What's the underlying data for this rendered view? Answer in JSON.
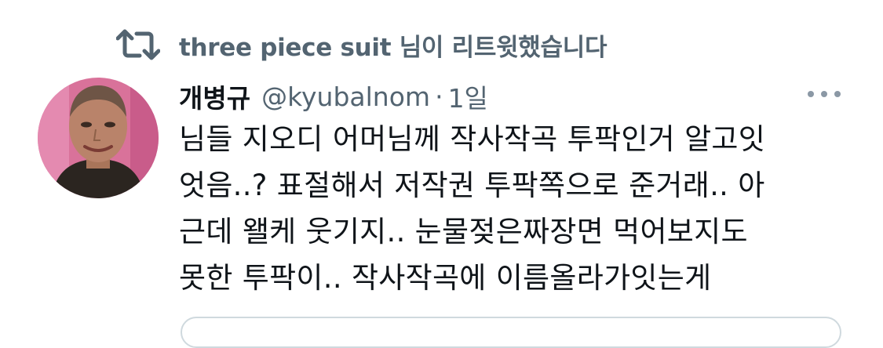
{
  "retweet": {
    "icon": "retweet-icon",
    "text": "three piece suit 님이 리트윗했습니다"
  },
  "tweet": {
    "author": {
      "display_name": "개병규",
      "handle": "@kyubalnom",
      "avatar": "avatar"
    },
    "separator": "·",
    "time": "1일",
    "more_icon": "more-icon",
    "lines": [
      "님들 지오디 어머님께 작사작곡 투팍인거 알고잇",
      "엇음..? 표절해서 저작권 투팍쪽으로 준거래.. 아",
      "근데 왤케 웃기지.. 눈물젖은짜장면 먹어보지도",
      "못한 투팍이.. 작사작곡에 이름올라가잇는게"
    ]
  },
  "colors": {
    "text_primary": "#0f1419",
    "text_secondary": "#536471",
    "border": "#cfd9de"
  }
}
